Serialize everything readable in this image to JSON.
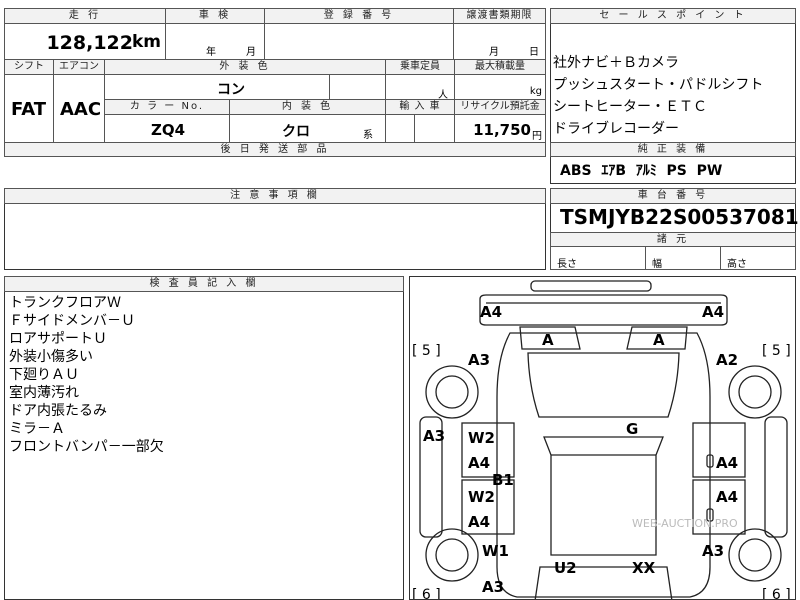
{
  "header": {
    "mileage_label": "走 行",
    "shaken_label": "車 検",
    "reg_label": "登 録 番 号",
    "transfer_label": "譲渡書類期限",
    "sales_label": "セ ー ル ス ポ イ ン ト"
  },
  "mileage": {
    "value": "128,122",
    "unit": "km"
  },
  "shaken": {
    "year": "年",
    "month": "月"
  },
  "transfer": {
    "month": "月",
    "day": "日"
  },
  "spec_headers": {
    "shift": "シフト",
    "ac": "エアコン",
    "exterior": "外 装 色",
    "capacity": "乗車定員",
    "max_load": "最大積載量",
    "color_no": "カ ラ ー  No.",
    "interior": "内 装 色",
    "import": "輸 入 車",
    "recycle": "リサイクル預託金"
  },
  "spec": {
    "shift": "FAT",
    "ac": "AAC",
    "exterior": "コン",
    "capacity_unit": "人",
    "load_unit": "kg",
    "color_no": "ZQ4",
    "interior": "クロ",
    "interior_suffix": "系",
    "recycle": "11,750",
    "recycle_unit": "円"
  },
  "parts_label": "後 日 発 送 部 品",
  "sales_points": [
    "社外ナビ＋Ｂカメラ",
    "プッシュスタート・パドルシフト",
    "シートヒーター・ＥＴＣ",
    "ドライブレコーダー"
  ],
  "std_equip": {
    "label": "純 正 装 備",
    "value": "ABS  ｴｱB  ｱﾙﾐ  PS  PW"
  },
  "caution_label": "注 意 事 項 欄",
  "chassis": {
    "label": "車 台 番 号",
    "value": "TSMJYB22S00537081"
  },
  "dims": {
    "label": "諸 元",
    "length": "長さ",
    "width": "幅",
    "height": "高さ"
  },
  "inspector": {
    "label": "検 査 員 記 入 欄",
    "notes": [
      "トランクフロアＷ",
      "Ｆサイドメンバ－Ｕ",
      "ロアサポートＵ",
      "外装小傷多い",
      "下廻りＡＵ",
      "室内薄汚れ",
      "ドア内張たるみ",
      "ミラ－Ａ",
      "フロントバンパ－一部欠"
    ]
  },
  "diagram": {
    "marks": {
      "front_left": "A4",
      "front_right": "A4",
      "headlight_left": "A",
      "headlight_right": "A",
      "fender_left": "A3",
      "fender_right": "A2",
      "bracket_left": "[ 5 ]",
      "bracket_right": "[ 5 ]",
      "side_left": "A3",
      "roof": "G",
      "door_fl_top": "W2",
      "door_fl_bottom": "A4",
      "b_pillar": "B1",
      "door_rl_top": "W2",
      "door_rl_bottom": "A4",
      "door_fr": "A4",
      "door_rr": "A4",
      "rear_fender_left": "W1",
      "rear_quarter_left": "A3",
      "rear_quarter_right": "A3",
      "trunk_left": "U2",
      "trunk_right": "XX",
      "bracket_bl": "[ 6 ]",
      "bracket_br": "[ 6 ]"
    },
    "watermark": "WEB-AUCTION.PRO"
  }
}
